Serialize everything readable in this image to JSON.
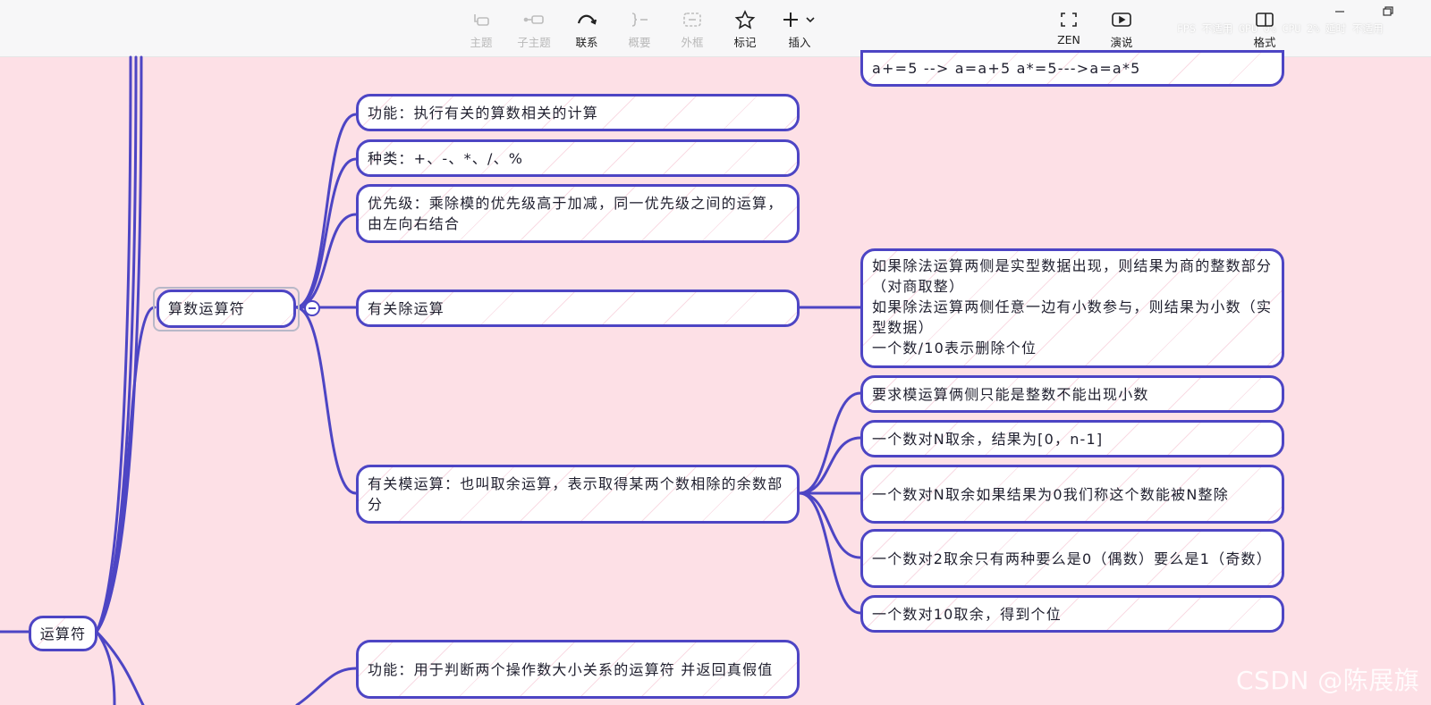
{
  "toolbar": {
    "topic": "主题",
    "subtopic": "子主题",
    "relationship": "联系",
    "summary": "概要",
    "boundary": "外框",
    "marker": "标记",
    "insert": "插入",
    "zen": "ZEN",
    "present": "演说",
    "format": "格式",
    "stats": "FPS 不适用 GPU 0% CPU 2% 延时 不适用"
  },
  "map": {
    "root": "运算符",
    "arith": "算数运算符",
    "assign_tail": "a+=5  --> a=a+5   a*=5--->a=a*5",
    "function": "功能：执行有关的算数相关的计算",
    "kinds": "种类：+、-、*、/、%",
    "priority": "优先级：乘除模的优先级高于加减，同一优先级之间的运算，由左向右结合",
    "division": "有关除运算",
    "division_detail": "如果除法运算两侧是实型数据出现，则结果为商的整数部分（对商取整）\n 如果除法运算两侧任意一边有小数参与，则结果为小数（实型数据）\n 一个数/10表示删除个位",
    "modulo": "有关模运算：也叫取余运算，表示取得某两个数相除的余数部分",
    "mod_1": "要求模运算俩侧只能是整数不能出现小数",
    "mod_2": "一个数对N取余，结果为[0，n-1]",
    "mod_3": "一个数对N取余如果结果为0我们称这个数能被N整除",
    "mod_4": "一个数对2取余只有两种要么是0（偶数）要么是1（奇数）",
    "mod_5": "一个数对10取余，得到个位",
    "relational_function": "功能：用于判断两个操作数大小关系的运算符 并返回真假值"
  },
  "watermark": "CSDN @陈展旗",
  "colors": {
    "background": "#fde0e6",
    "branch": "#4d45c4",
    "node_fill": "#ffffff"
  }
}
